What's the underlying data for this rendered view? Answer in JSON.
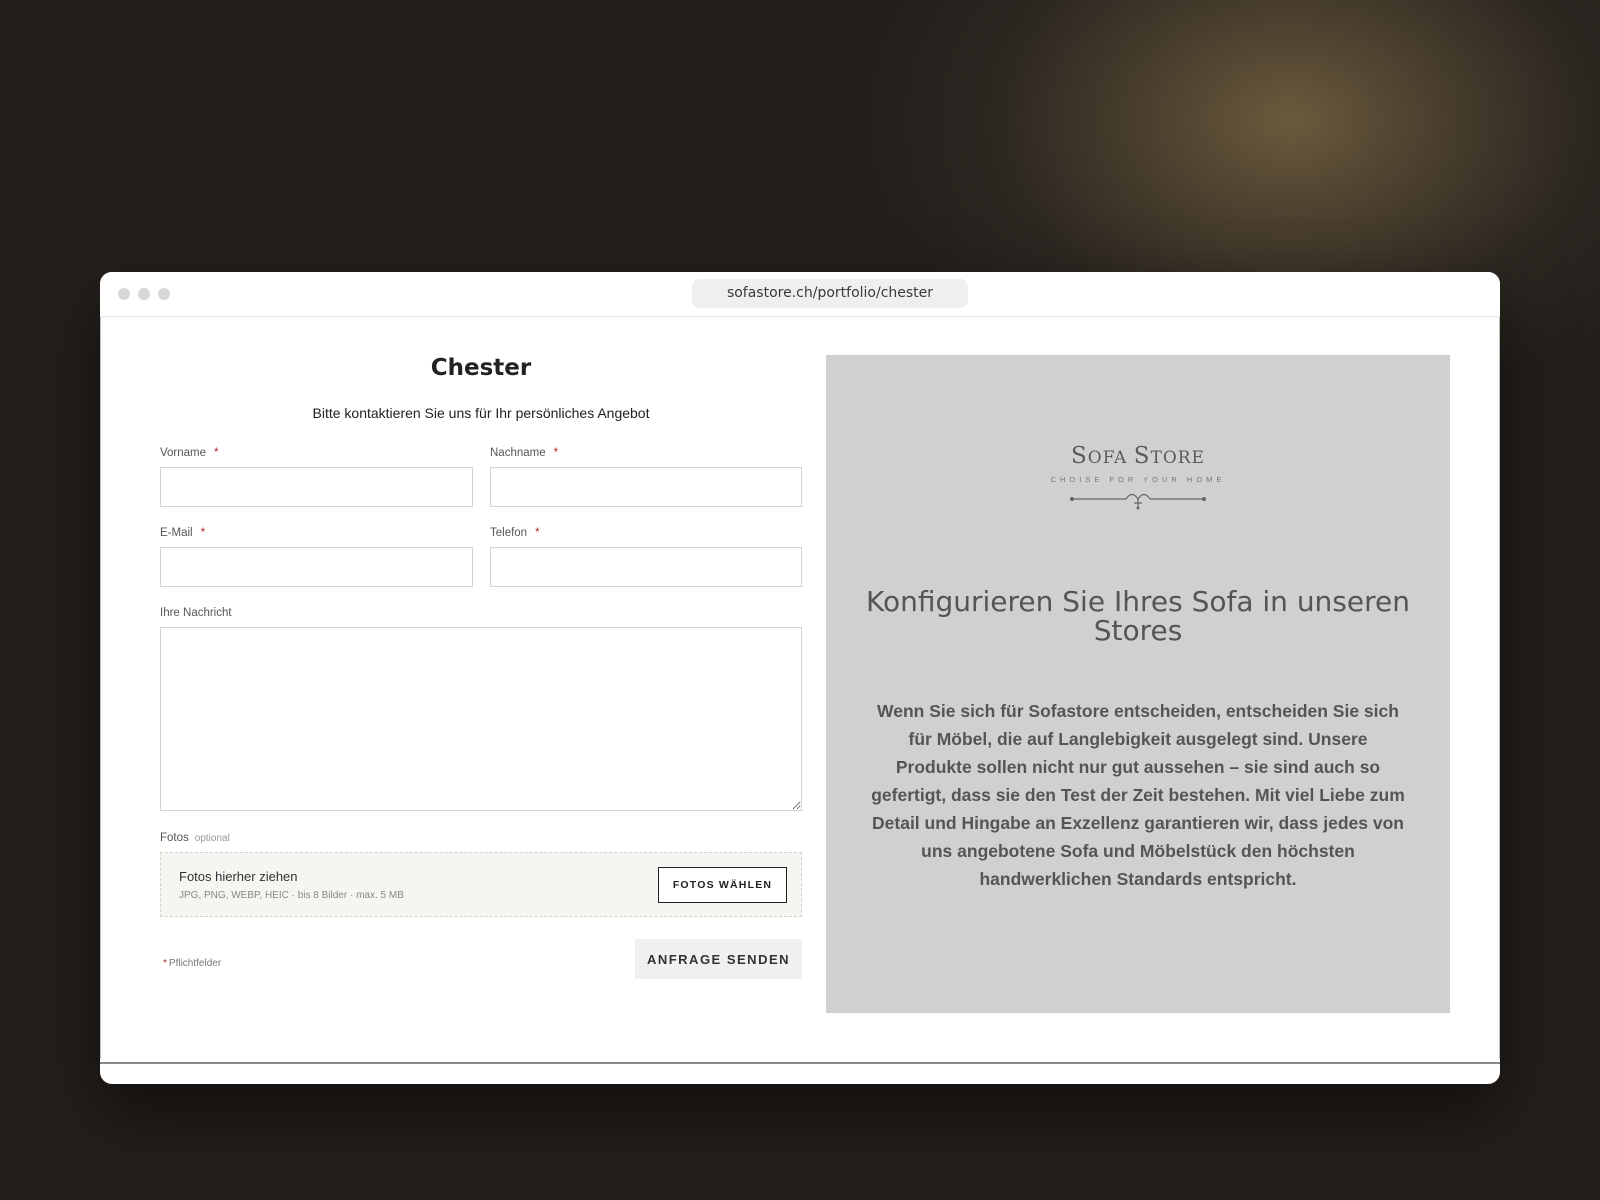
{
  "browser": {
    "url": "sofastore.ch/portfolio/chester"
  },
  "form": {
    "title": "Chester",
    "subtitle": "Bitte kontaktieren Sie uns für Ihr persönliches Angebot",
    "fields": {
      "vorname": {
        "label": "Vorname",
        "value": "",
        "required_mark": "*"
      },
      "nachname": {
        "label": "Nachname",
        "value": "",
        "required_mark": "*"
      },
      "email": {
        "label": "E-Mail",
        "value": "",
        "required_mark": "*"
      },
      "telefon": {
        "label": "Telefon",
        "value": "",
        "required_mark": "*"
      },
      "nachricht": {
        "label": "Ihre Nachricht",
        "value": ""
      }
    },
    "fotos": {
      "label": "Fotos",
      "optional": "optional",
      "drop_title": "Fotos hierher ziehen",
      "drop_hint": "JPG, PNG, WEBP, HEIC · bis 8 Bilder · max. 5 MB",
      "choose_button": "FOTOS WÄHLEN"
    },
    "required_note": "Pflichtfelder",
    "required_note_mark": "*",
    "submit_button": "ANFRAGE SENDEN"
  },
  "panel": {
    "logo": {
      "name_first": "S",
      "name_rest1": "OFA ",
      "name_second": "S",
      "name_rest2": "TORE",
      "tagline": "CHOISE FOR YOUR HOME"
    },
    "title": "Konfigurieren Sie Ihres Sofa in unseren Stores",
    "text": "Wenn Sie sich für Sofastore entscheiden, entscheiden Sie sich für Möbel, die auf Langlebigkeit ausgelegt sind. Unsere Produkte sollen nicht nur gut aussehen – sie sind auch so gefertigt, dass sie den Test der Zeit bestehen. Mit viel Liebe zum Detail und Hingabe an Exzellenz garantieren wir, dass jedes von uns angebotene Sofa und Möbelstück den höchsten handwerklichen Standards entspricht."
  },
  "colors": {
    "required": "#b3262d",
    "panel_bg": "#d1d0d1"
  }
}
